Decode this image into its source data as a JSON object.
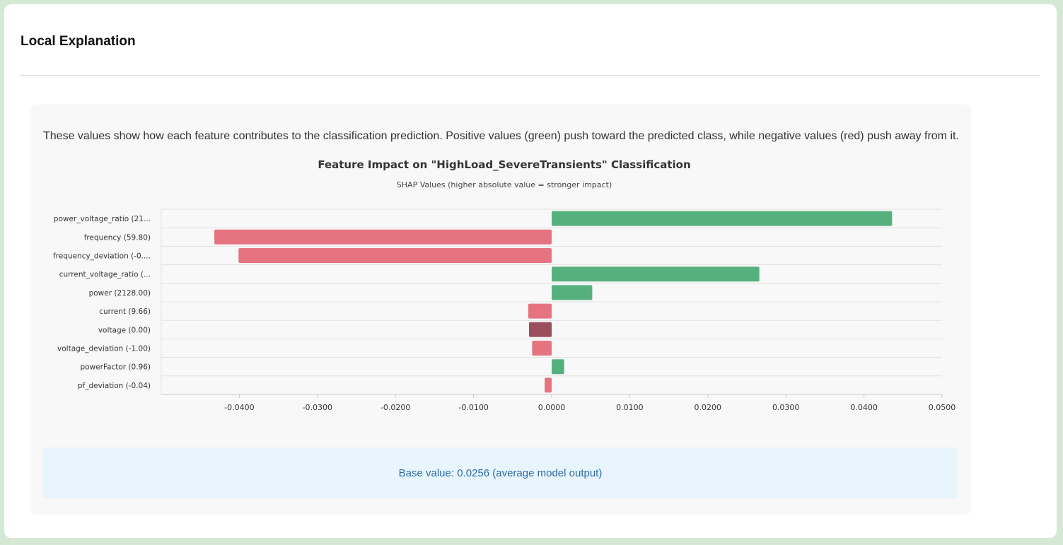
{
  "header": {
    "title": "Local Explanation"
  },
  "panel": {
    "description": "These values show how each feature contributes to the classification prediction. Positive values (green) push toward the predicted class, while negative values (red) push away from it.",
    "base_value_text": "Base value: 0.0256 (average model output)"
  },
  "colors": {
    "positive": "#55b07e",
    "negative": "#e57480",
    "highlight": "#9b4f5c",
    "grid": "#e2e2e2",
    "axis": "#cccccc",
    "text": "#333333"
  },
  "chart_data": {
    "type": "bar",
    "orientation": "horizontal",
    "title": "Feature Impact on \"HighLoad_SevereTransients\" Classification",
    "subtitle": "SHAP Values (higher absolute value = stronger impact)",
    "xlim": [
      -0.05,
      0.05
    ],
    "x_ticks": [
      -0.04,
      -0.03,
      -0.02,
      -0.01,
      0,
      0.01,
      0.02,
      0.03,
      0.04,
      0.05
    ],
    "x_tick_labels": [
      "-0.0400",
      "-0.0300",
      "-0.0200",
      "-0.0100",
      "0.0000",
      "0.0100",
      "0.0200",
      "0.0300",
      "0.0400",
      "0.0500"
    ],
    "categories": [
      "power_voltage_ratio (21...",
      "frequency (59.80)",
      "frequency_deviation (-0....",
      "current_voltage_ratio (...",
      "power (2128.00)",
      "current (9.66)",
      "voltage (0.00)",
      "voltage_deviation (-1.00)",
      "powerFactor (0.96)",
      "pf_deviation (-0.04)"
    ],
    "values": [
      0.0436,
      -0.0432,
      -0.0401,
      0.0266,
      0.0052,
      -0.003,
      -0.0029,
      -0.0025,
      0.0016,
      -0.0009
    ],
    "highlighted_index": 6,
    "grid": true
  }
}
